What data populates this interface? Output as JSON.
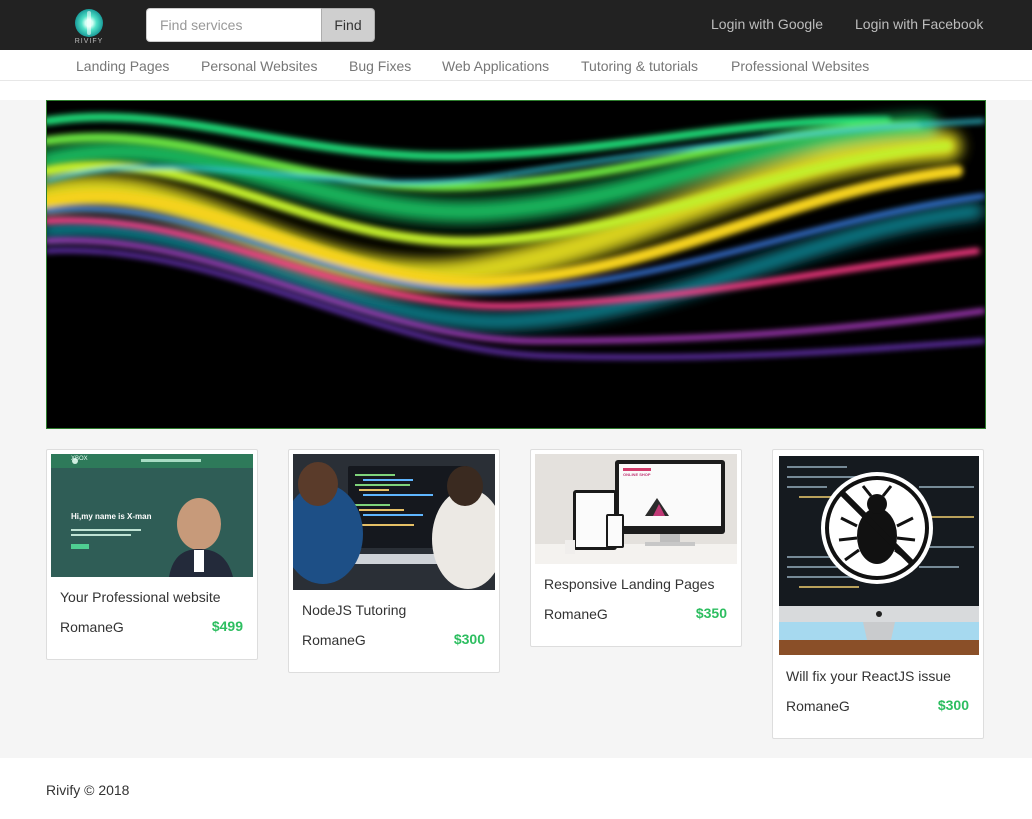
{
  "brand": {
    "logo_text": "RIVIFY"
  },
  "search": {
    "placeholder": "Find services",
    "value": "",
    "button_label": "Find"
  },
  "auth": {
    "google_label": "Login with Google",
    "facebook_label": "Login with Facebook"
  },
  "categories": [
    "Landing Pages",
    "Personal Websites",
    "Bug Fixes",
    "Web Applications",
    "Tutoring & tutorials",
    "Professional Websites"
  ],
  "listings": [
    {
      "title": "Your Professional website",
      "author": "RomaneG",
      "price": "$499",
      "thumbnail": {
        "heading": "Hi,my name is X-man",
        "nav_brand": "XBOX"
      }
    },
    {
      "title": "NodeJS Tutoring",
      "author": "RomaneG",
      "price": "$300"
    },
    {
      "title": "Responsive Landing Pages",
      "author": "RomaneG",
      "price": "$350",
      "thumbnail": {
        "heading": "ONLINE SHOP"
      }
    },
    {
      "title": "Will fix your ReactJS issue",
      "author": "RomaneG",
      "price": "$300"
    }
  ],
  "footer": {
    "text": "Rivify © 2018"
  },
  "colors": {
    "topbar": "#222222",
    "price": "#2dbe60",
    "hero_border": "#2d7d2d",
    "page_bg": "#f5f5f5"
  }
}
